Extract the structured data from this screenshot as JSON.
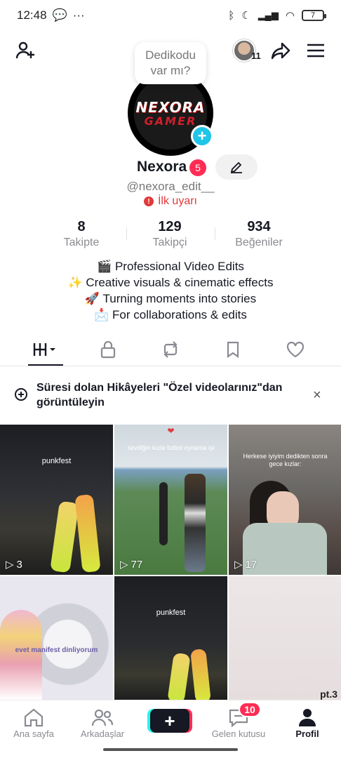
{
  "status": {
    "time": "12:48",
    "battery": "7"
  },
  "bubble_text": "Dedikodu var mı?",
  "story_count": "11",
  "logo": {
    "line1": "NEXORA",
    "line2": "GAMER"
  },
  "profile": {
    "name": "Nexora",
    "name_badge": "5",
    "username": "@nexora_edit__",
    "warning": "İlk uyarı"
  },
  "stats": [
    {
      "value": "8",
      "label": "Takipte"
    },
    {
      "value": "129",
      "label": "Takipçi"
    },
    {
      "value": "934",
      "label": "Beğeniler"
    }
  ],
  "bio": [
    "🎬 Professional Video Edits",
    "✨ Creative visuals & cinematic effects",
    "🚀 Turning moments into stories",
    "📩 For collaborations & edits"
  ],
  "banner": {
    "text": "Süresi dolan Hikâyeleri \"Özel videolarınız\"dan görüntüleyin",
    "close": "×"
  },
  "videos": [
    {
      "caption": "punkfest",
      "views": "3"
    },
    {
      "caption": "sevdiğin kızla futbol oynama işi",
      "views": "77"
    },
    {
      "caption": "Herkese iyiyim dedikten sonra gece kızlar:",
      "views": "17"
    },
    {
      "caption": "evet manifest dinliyorum",
      "views": ""
    },
    {
      "caption": "punkfest",
      "views": ""
    },
    {
      "caption": "pt.3",
      "views": ""
    }
  ],
  "nav": {
    "home": "Ana sayfa",
    "friends": "Arkadaşlar",
    "create": "+",
    "inbox": "Gelen kutusu",
    "inbox_badge": "10",
    "profile": "Profil"
  }
}
